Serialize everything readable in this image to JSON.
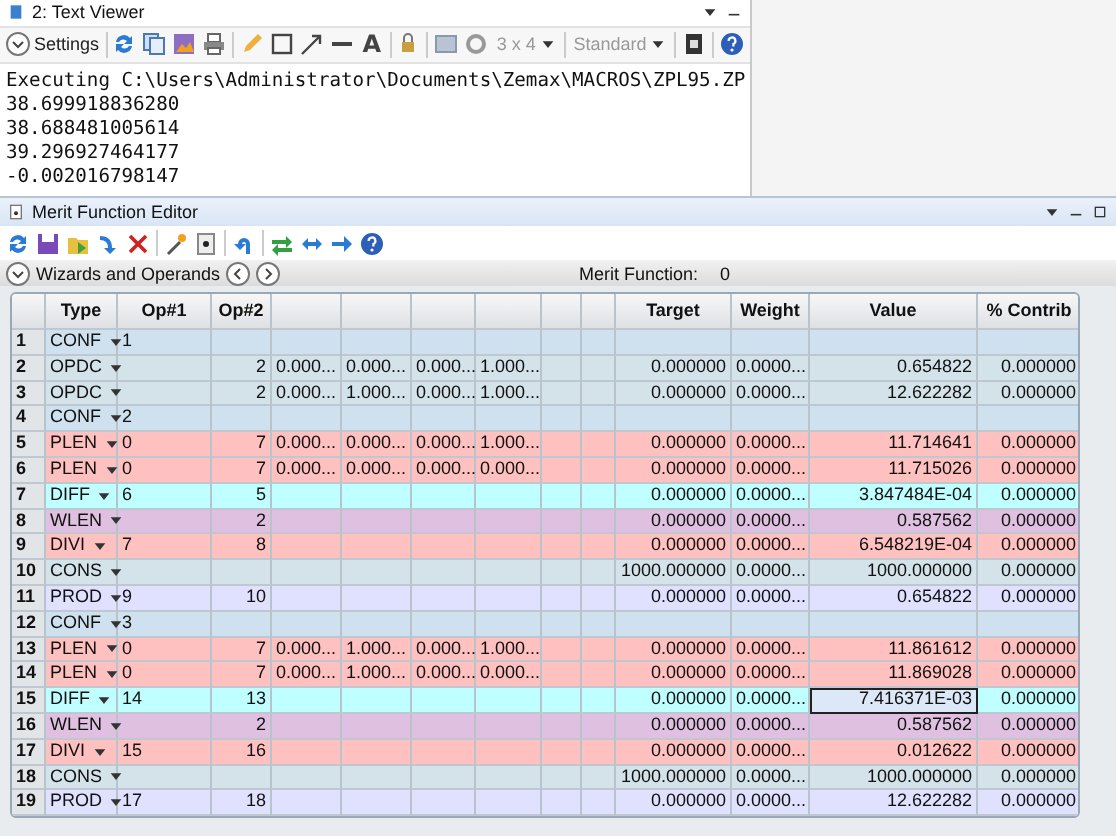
{
  "text_viewer": {
    "title": "2: Text Viewer",
    "settings_label": "Settings",
    "text_tool": "A",
    "dropdowns": [
      {
        "label": "3 x 4",
        "disabled": true
      },
      {
        "label": "Standard",
        "disabled": true
      }
    ],
    "lines": [
      "Executing C:\\Users\\Administrator\\Documents\\Zemax\\MACROS\\ZPL95.ZP",
      "38.699918836280",
      "38.688481005614",
      "39.296927464177",
      "-0.002016798147"
    ]
  },
  "merit_editor": {
    "title": "Merit Function Editor",
    "wizards_label": "Wizards and Operands",
    "merit_label": "Merit Function:",
    "merit_value": "0",
    "columns": [
      "Type",
      "Op#1",
      "Op#2",
      "",
      "",
      "",
      "",
      "",
      "",
      "Target",
      "Weight",
      "Value",
      "% Contrib"
    ],
    "rows": [
      {
        "n": "1",
        "type": "CONF",
        "op1": "1",
        "color": "#cfe1ef",
        "selected": false
      },
      {
        "n": "2",
        "type": "OPDC",
        "op2": "2",
        "params": [
          "0.000...",
          "0.000...",
          "0.000...",
          "1.000..."
        ],
        "target": "0.000000",
        "weight": "0.0000...",
        "value": "0.654822",
        "contrib": "0.000000",
        "color": "#d4e3ea",
        "selected": false
      },
      {
        "n": "3",
        "type": "OPDC",
        "op2": "2",
        "params": [
          "0.000...",
          "1.000...",
          "0.000...",
          "1.000..."
        ],
        "target": "0.000000",
        "weight": "0.0000...",
        "value": "12.622282",
        "contrib": "0.000000",
        "color": "#d4e3ea",
        "selected": false
      },
      {
        "n": "4",
        "type": "CONF",
        "op1": "2",
        "color": "#cfe1ef",
        "selected": false
      },
      {
        "n": "5",
        "type": "PLEN",
        "op1": "0",
        "op2": "7",
        "params": [
          "0.000...",
          "0.000...",
          "0.000...",
          "1.000..."
        ],
        "target": "0.000000",
        "weight": "0.0000...",
        "value": "11.714641",
        "contrib": "0.000000",
        "color": "#ffc0c0",
        "selected": false
      },
      {
        "n": "6",
        "type": "PLEN",
        "op1": "0",
        "op2": "7",
        "params": [
          "0.000...",
          "0.000...",
          "0.000...",
          "0.000..."
        ],
        "target": "0.000000",
        "weight": "0.0000...",
        "value": "11.715026",
        "contrib": "0.000000",
        "color": "#ffc0c0",
        "selected": false
      },
      {
        "n": "7",
        "type": "DIFF",
        "op1": "6",
        "op2": "5",
        "target": "0.000000",
        "weight": "0.0000...",
        "value": "3.847484E-04",
        "contrib": "0.000000",
        "color": "#c0ffff",
        "selected": false
      },
      {
        "n": "8",
        "type": "WLEN",
        "op2": "2",
        "target": "0.000000",
        "weight": "0.0000...",
        "value": "0.587562",
        "contrib": "0.000000",
        "color": "#e0c0e0",
        "selected": false
      },
      {
        "n": "9",
        "type": "DIVI",
        "op1": "7",
        "op2": "8",
        "target": "0.000000",
        "weight": "0.0000...",
        "value": "6.548219E-04",
        "contrib": "0.000000",
        "color": "#ffc0c0",
        "selected": false
      },
      {
        "n": "10",
        "type": "CONS",
        "target": "1000.000000",
        "weight": "0.0000...",
        "value": "1000.000000",
        "contrib": "0.000000",
        "color": "#d4e3ea",
        "selected": false
      },
      {
        "n": "11",
        "type": "PROD",
        "op1": "9",
        "op2": "10",
        "target": "0.000000",
        "weight": "0.0000...",
        "value": "0.654822",
        "contrib": "0.000000",
        "color": "#e0e0ff",
        "selected": false
      },
      {
        "n": "12",
        "type": "CONF",
        "op1": "3",
        "color": "#cfe1ef",
        "selected": false
      },
      {
        "n": "13",
        "type": "PLEN",
        "op1": "0",
        "op2": "7",
        "params": [
          "0.000...",
          "1.000...",
          "0.000...",
          "1.000..."
        ],
        "target": "0.000000",
        "weight": "0.0000...",
        "value": "11.861612",
        "contrib": "0.000000",
        "color": "#ffc0c0",
        "selected": false
      },
      {
        "n": "14",
        "type": "PLEN",
        "op1": "0",
        "op2": "7",
        "params": [
          "0.000...",
          "1.000...",
          "0.000...",
          "0.000..."
        ],
        "target": "0.000000",
        "weight": "0.0000...",
        "value": "11.869028",
        "contrib": "0.000000",
        "color": "#ffc0c0",
        "selected": false
      },
      {
        "n": "15",
        "type": "DIFF",
        "op1": "14",
        "op2": "13",
        "target": "0.000000",
        "weight": "0.0000...",
        "value": "7.416371E-03",
        "contrib": "0.000000",
        "color": "#c0ffff",
        "selected": true
      },
      {
        "n": "16",
        "type": "WLEN",
        "op2": "2",
        "target": "0.000000",
        "weight": "0.0000...",
        "value": "0.587562",
        "contrib": "0.000000",
        "color": "#e0c0e0",
        "selected": false
      },
      {
        "n": "17",
        "type": "DIVI",
        "op1": "15",
        "op2": "16",
        "target": "0.000000",
        "weight": "0.0000...",
        "value": "0.012622",
        "contrib": "0.000000",
        "color": "#ffc0c0",
        "selected": false
      },
      {
        "n": "18",
        "type": "CONS",
        "target": "1000.000000",
        "weight": "0.0000...",
        "value": "1000.000000",
        "contrib": "0.000000",
        "color": "#d4e3ea",
        "selected": false
      },
      {
        "n": "19",
        "type": "PROD",
        "op1": "17",
        "op2": "18",
        "target": "0.000000",
        "weight": "0.0000...",
        "value": "12.622282",
        "contrib": "0.000000",
        "color": "#e0e0ff",
        "selected": false
      }
    ]
  }
}
